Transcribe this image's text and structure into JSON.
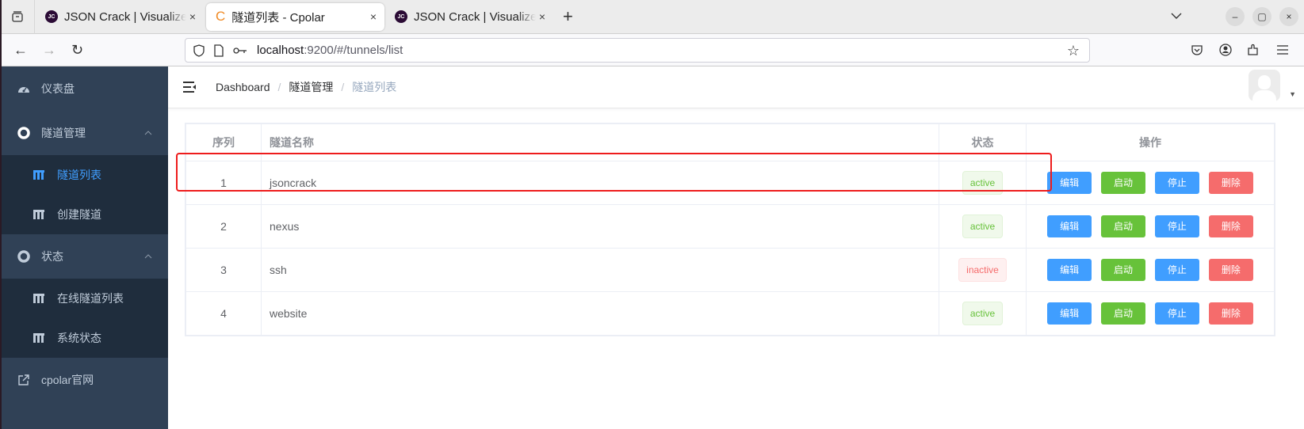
{
  "browser": {
    "tabs": [
      {
        "title": "JSON Crack | Visualize Ins",
        "favicon": "JC",
        "active": false
      },
      {
        "title": "隧道列表 - Cpolar",
        "favicon": "C",
        "active": true
      },
      {
        "title": "JSON Crack | Visualize Ins",
        "favicon": "JC",
        "active": false
      }
    ],
    "url_host": "localhost",
    "url_rest": ":9200/#/tunnels/list",
    "icons": {
      "close": "×",
      "new_tab": "+",
      "back": "←",
      "forward": "→",
      "reload": "↻",
      "star": "☆",
      "chevron": "⌄",
      "minimize": "–",
      "maximize": "▢",
      "window_close": "×"
    }
  },
  "sidebar": {
    "items": [
      {
        "label": "仪表盘",
        "icon": "dashboard-icon"
      },
      {
        "label": "隧道管理",
        "icon": "lifebuoy-icon",
        "expanded": true,
        "children": [
          {
            "label": "隧道列表",
            "active": true
          },
          {
            "label": "创建隧道"
          }
        ]
      },
      {
        "label": "状态",
        "icon": "lifebuoy-icon",
        "expanded": true,
        "children": [
          {
            "label": "在线隧道列表"
          },
          {
            "label": "系统状态"
          }
        ]
      },
      {
        "label": "cpolar官网",
        "icon": "external-link-icon"
      }
    ]
  },
  "header": {
    "breadcrumb": [
      "Dashboard",
      "隧道管理",
      "隧道列表"
    ]
  },
  "table": {
    "columns": [
      "序列",
      "隧道名称",
      "状态",
      "操作"
    ],
    "actions": {
      "edit": "编辑",
      "start": "启动",
      "stop": "停止",
      "delete": "删除"
    },
    "rows": [
      {
        "index": "1",
        "name": "jsoncrack",
        "status": "active"
      },
      {
        "index": "2",
        "name": "nexus",
        "status": "active"
      },
      {
        "index": "3",
        "name": "ssh",
        "status": "inactive"
      },
      {
        "index": "4",
        "name": "website",
        "status": "active"
      }
    ]
  },
  "colors": {
    "sidebar_bg": "#304156",
    "submenu_bg": "#1f2d3d",
    "primary": "#409eff",
    "success": "#67c23a",
    "danger": "#f56c6c",
    "highlight": "#ee1c1c"
  }
}
